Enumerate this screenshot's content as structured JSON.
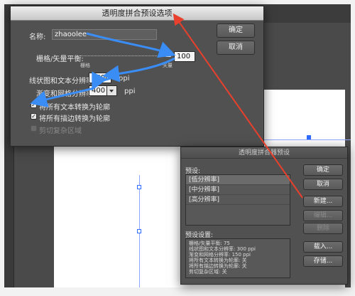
{
  "dialog_main": {
    "title": "透明度拼合预设选项",
    "name_label": "名称:",
    "name_value": "zhaoolee",
    "raster_label": "栅格/矢量平衡:",
    "raster_value": "100",
    "raster_left": "栅格",
    "raster_right": "矢量",
    "line_res_label": "线状图和文本分辨率:",
    "line_res_value": "1600",
    "line_res_unit": "ppi",
    "gradient_res_label": "渐变和网格分辨率:",
    "gradient_res_value": "400",
    "gradient_res_unit": "ppi",
    "check_text": "将所有文本转换为轮廓",
    "check_strokes": "将所有描边转换为轮廓",
    "check_clip": "剪切复杂区域",
    "ok": "确定",
    "cancel": "取消"
  },
  "dialog_presets": {
    "title": "透明度拼合器预设",
    "presets_label": "预设:",
    "presets": [
      "[低分辨率]",
      "[中分辨率]",
      "[高分辨率]"
    ],
    "settings_label": "预设设置:",
    "settings_lines": [
      "栅格/矢量平衡: 75",
      "线状图和文本分辨率: 300 ppi",
      "渐变和网格分辨率: 150 ppi",
      "将所有文本转换为轮廓: 关",
      "将所有描边转换为轮廓: 关",
      "剪切复杂区域: 关"
    ],
    "ok": "确定",
    "cancel": "取消",
    "new": "新建...",
    "edit": "编辑...",
    "delete": "删除",
    "load": "载入...",
    "save": "存储..."
  },
  "colors": {
    "annotation_arrow_blue": "#3a8df5",
    "annotation_arrow_red": "#e8402c"
  }
}
